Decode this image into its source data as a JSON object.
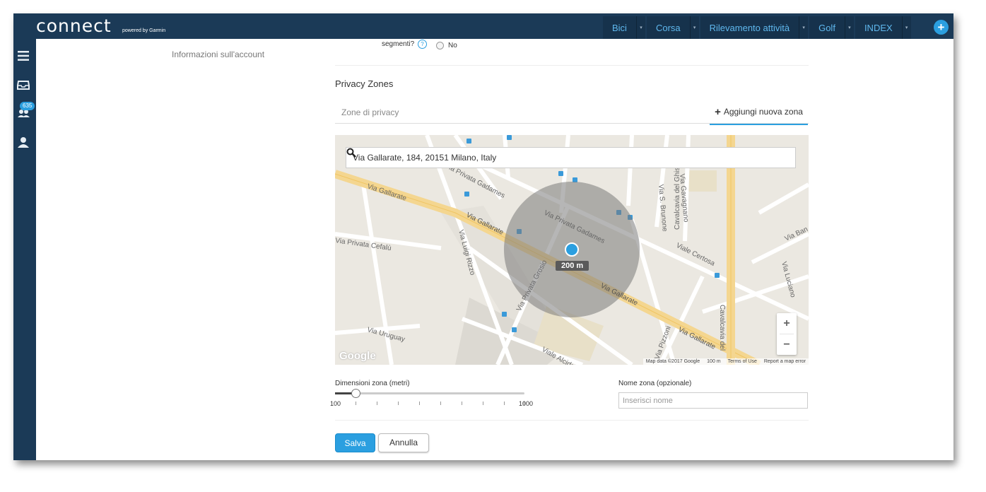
{
  "app": {
    "logo": "connect",
    "logo_sub": "powered by Garmin"
  },
  "nav": {
    "items": [
      {
        "label": "Bici"
      },
      {
        "label": "Corsa"
      },
      {
        "label": "Rilevamento attività"
      },
      {
        "label": "Golf"
      },
      {
        "label": "INDEX"
      }
    ],
    "add_icon": "plus-icon"
  },
  "sidebar": {
    "badge": "635",
    "icons": [
      "menu-icon",
      "inbox-icon",
      "connections-icon",
      "user-icon"
    ]
  },
  "account_link": "Informazioni sull'account",
  "segments": {
    "question": "segmenti?",
    "option": "No"
  },
  "privacy": {
    "title": "Privacy Zones",
    "tab_zones": "Zone di privacy",
    "add_zone": "Aggiungi nuova zona"
  },
  "map": {
    "search_value": "Via Gallarate, 184, 20151 Milano, Italy",
    "radius_label": "200 m",
    "zoom_in": "+",
    "zoom_out": "−",
    "google": "Google",
    "attribution": {
      "data": "Map data ©2017 Google",
      "scale": "100 m",
      "terms": "Terms of Use",
      "report": "Report a map error"
    },
    "streets": [
      "Via Gallarate",
      "Via Gallarate",
      "Via Privata Gadames",
      "Via Privata Gadames",
      "Via Privata Cefalù",
      "Via Luigi Rizzo",
      "Via Privata Grosio",
      "Via Gallarate",
      "Via Gallarate",
      "Viale Certosa",
      "Via S. Brunone",
      "Via Gavagnano",
      "Cavalcavia del Ghisallo",
      "Cavalcavia del",
      "Via Luciano",
      "Via Ban",
      "Via Uruguay",
      "Viale Alcide",
      "Via Pizzoni"
    ]
  },
  "zone_size": {
    "label": "Dimensioni zona (metri)",
    "min": "100",
    "max": "1000",
    "value": 200
  },
  "zone_name": {
    "label": "Nome zona (opzionale)",
    "placeholder": "Inserisci nome"
  },
  "actions": {
    "save": "Salva",
    "cancel": "Annulla"
  },
  "colors": {
    "header": "#1b3a57",
    "accent": "#2b9fe0",
    "zone": "#7a7a7a"
  }
}
